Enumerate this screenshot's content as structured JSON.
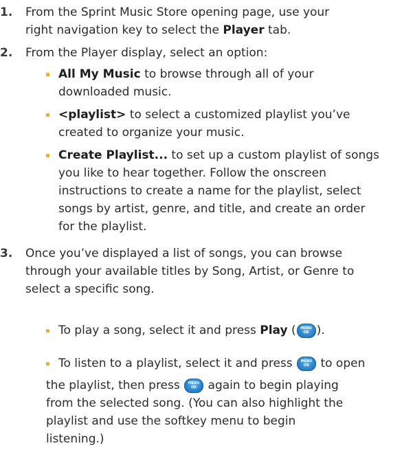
{
  "menu_key": {
    "line1": "MENU",
    "line2": "OK"
  },
  "step1": {
    "number": "1.",
    "text_a": "From the Sprint Music Store opening page, use your",
    "text_b": "right navigation key to select the ",
    "bold": "Player",
    "text_c": " tab."
  },
  "step2": {
    "number": "2.",
    "text": "From the Player display, select an option:",
    "options": [
      {
        "bold": "All My Music",
        "line1": " to browse through all of your",
        "line2": "downloaded music."
      },
      {
        "bold": "<playlist>",
        "line1": " to select a customized playlist you’ve",
        "line2": "created to organize your music."
      },
      {
        "bold": "Create Playlist...",
        "line1": " to set up a custom playlist of songs",
        "line2": "you like to hear together. Follow the onscreen",
        "line3": "instructions to create a name for the playlist, select",
        "line4": "songs by artist, genre, and title, and create an order",
        "line5": "for the playlist."
      }
    ]
  },
  "step3": {
    "number": "3.",
    "line1": "Once you’ve displayed a list of songs, you can browse",
    "line2": "through your available titles by Song, Artist, or Genre to",
    "line3": "select a specific song.",
    "tip1": {
      "text_a": "To play a song, select it and press ",
      "bold": "Play",
      "text_b": " (",
      "text_c": ")."
    },
    "tip2": {
      "text_a": "To listen to a playlist, select it and press ",
      "text_b": " to open",
      "text_c": "the playlist, then press ",
      "text_d": " again to begin playing",
      "line3": "from the selected song. (You can also highlight the",
      "line4": "playlist and use the softkey menu to begin",
      "line5": "listening.)"
    }
  }
}
